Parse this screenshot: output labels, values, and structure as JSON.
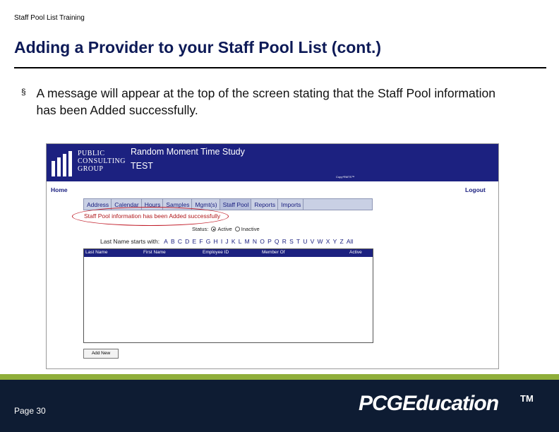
{
  "slide": {
    "header": "Staff Pool List Training",
    "title": "Adding a Provider to your Staff Pool List (cont.)",
    "bullet_mark": "§",
    "bullet_text": "A message will appear at the top of the screen stating that the Staff Pool information has been Added successfully."
  },
  "app": {
    "logo_lines": [
      "PUBLIC",
      "CONSULTING",
      "GROUP"
    ],
    "title": "Random Moment Time Study",
    "subtitle": "TEST",
    "copyright": "Copy*RMTS™",
    "home": "Home",
    "logout": "Logout",
    "nav_tabs": [
      "Address",
      "Calendar",
      "Hours",
      "Samples",
      "Mgmt(s)",
      "Staff Pool",
      "Reports",
      "Imports"
    ],
    "active_tab": "Staff Pool",
    "success_message": "Staff Pool information has been Added successfully",
    "status": {
      "label": "Status:",
      "options": [
        "Active",
        "Inactive"
      ],
      "selected": "Active"
    },
    "alpha": {
      "label": "Last Name starts with:",
      "letters": [
        "A",
        "B",
        "C",
        "D",
        "E",
        "F",
        "G",
        "H",
        "I",
        "J",
        "K",
        "L",
        "M",
        "N",
        "O",
        "P",
        "Q",
        "R",
        "S",
        "T",
        "U",
        "V",
        "W",
        "X",
        "Y",
        "Z",
        "All"
      ]
    },
    "table_headers": [
      "Last Name",
      "First Name",
      "Employee ID",
      "Member Of",
      "Active"
    ],
    "add_button": "Add New"
  },
  "footer": {
    "page": "Page 30",
    "brand": "PCGEducation",
    "trademark": "TM"
  },
  "colors": {
    "banner": "#1c2180",
    "title": "#0d1a57",
    "success": "#b0181b",
    "footer": "#0e1c33",
    "accent": "#8fae3a"
  }
}
